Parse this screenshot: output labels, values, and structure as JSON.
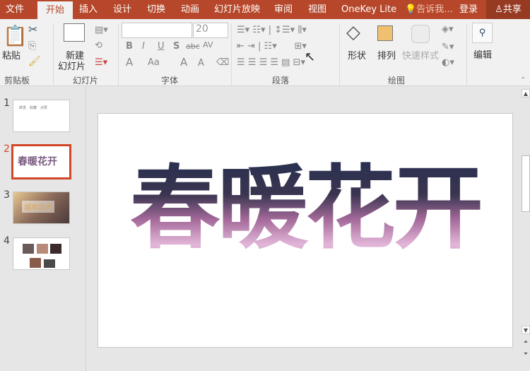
{
  "tabs": [
    "文件",
    "开始",
    "插入",
    "设计",
    "切换",
    "动画",
    "幻灯片放映",
    "审阅",
    "视图",
    "OneKey Lite"
  ],
  "tell_me": "告诉我...",
  "login": "登录",
  "share": "共享",
  "ribbon": {
    "clipboard": {
      "paste": "粘贴",
      "label": "剪贴板"
    },
    "slides": {
      "new_slide_1": "新建",
      "new_slide_2": "幻灯片",
      "label": "幻灯片"
    },
    "font": {
      "font_name": "",
      "font_size": "20",
      "bold": "B",
      "italic": "I",
      "underline": "U",
      "shadow": "S",
      "strike": "abc",
      "spacing": "AV",
      "color": "A",
      "case": "Aa",
      "grow": "A",
      "shrink": "A",
      "label": "字体"
    },
    "paragraph": {
      "label": "段落"
    },
    "drawing": {
      "shape": "形状",
      "arrange": "排列",
      "quick_styles": "快速样式",
      "label": "绘图"
    },
    "editing": {
      "label": "编辑"
    }
  },
  "slides": [
    {
      "number": "1",
      "text": "转发　收藏　点赞"
    },
    {
      "number": "2",
      "text": "春暖花开"
    },
    {
      "number": "3",
      "text": "城市风光"
    },
    {
      "number": "4",
      "text": ""
    }
  ],
  "main_slide": {
    "title": "春暖花开"
  },
  "colors": {
    "accent": "#b7472a",
    "selected": "#d24726"
  }
}
